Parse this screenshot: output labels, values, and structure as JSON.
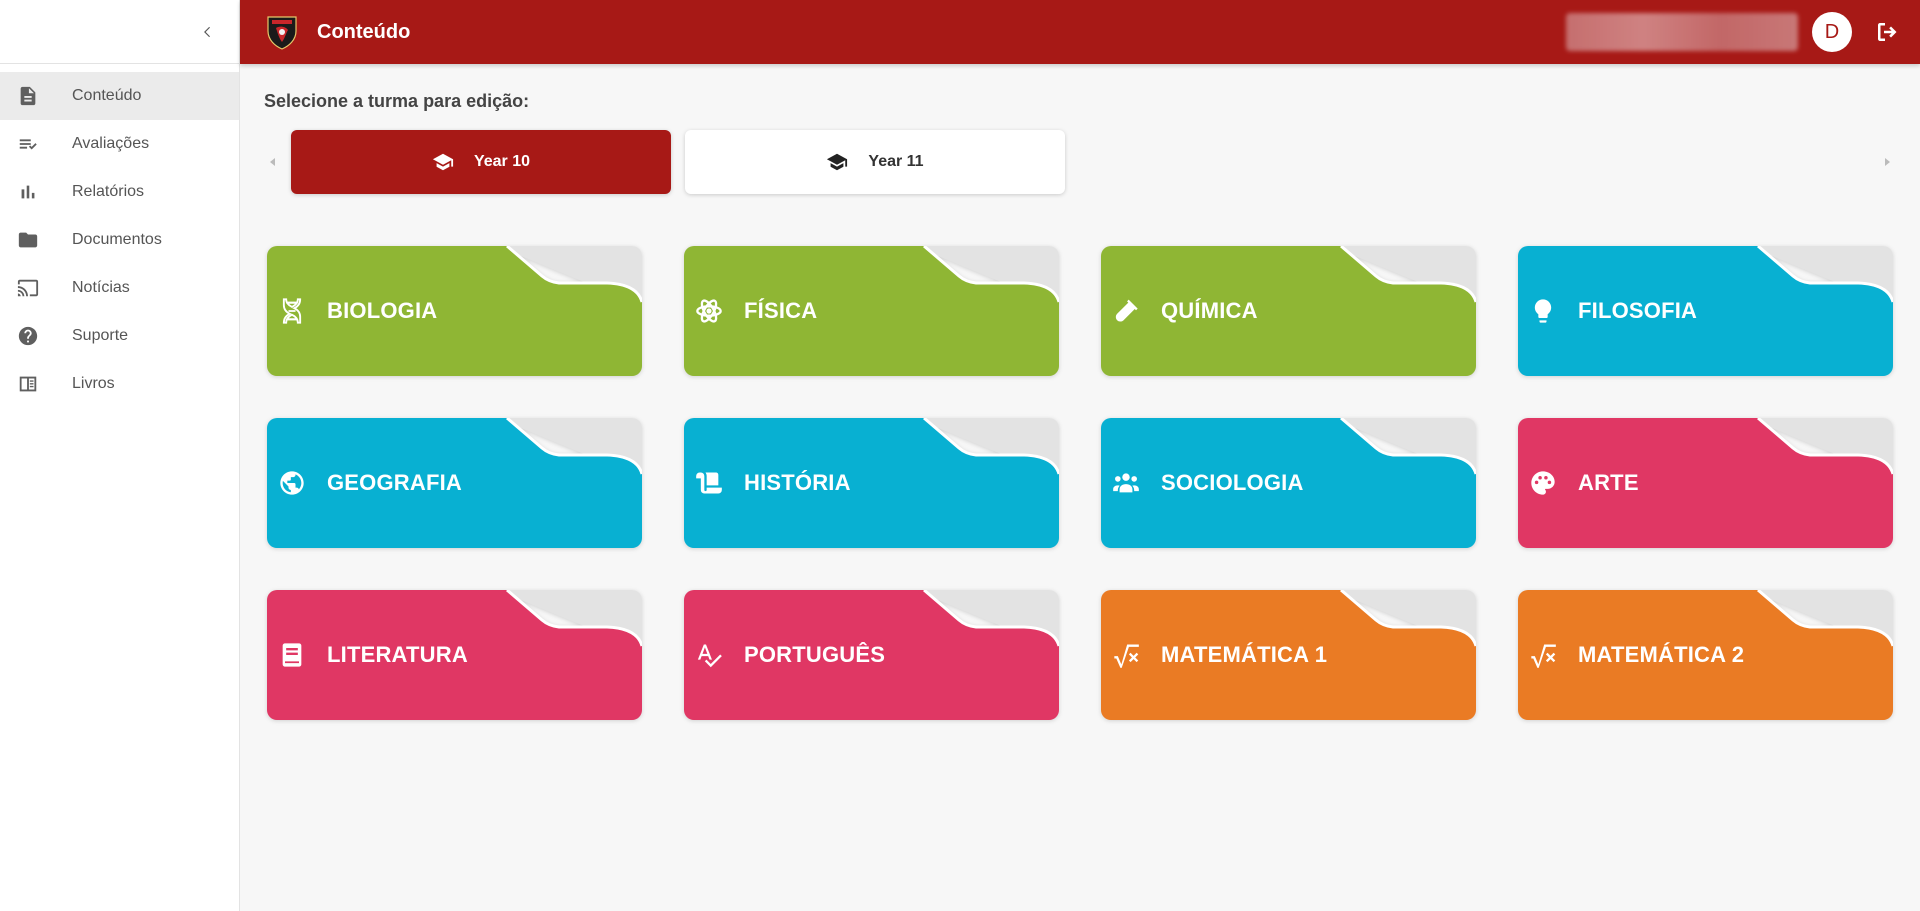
{
  "header": {
    "title": "Conteúdo",
    "avatar_initial": "D",
    "accent_color": "#a71916"
  },
  "sidebar": {
    "items": [
      {
        "label": "Conteúdo",
        "icon": "document-icon",
        "active": true
      },
      {
        "label": "Avaliações",
        "icon": "checklist-icon",
        "active": false
      },
      {
        "label": "Relatórios",
        "icon": "bar-chart-icon",
        "active": false
      },
      {
        "label": "Documentos",
        "icon": "folder-icon",
        "active": false
      },
      {
        "label": "Notícias",
        "icon": "cast-icon",
        "active": false
      },
      {
        "label": "Suporte",
        "icon": "help-icon",
        "active": false
      },
      {
        "label": "Livros",
        "icon": "book-icon",
        "active": false
      }
    ]
  },
  "main": {
    "section_title": "Selecione a turma para edição:",
    "classes": [
      {
        "label": "Year 10",
        "selected": true
      },
      {
        "label": "Year 11",
        "selected": false
      }
    ],
    "subjects": [
      {
        "label": "BIOLOGIA",
        "icon": "dna-icon",
        "color": "#8fb634"
      },
      {
        "label": "FÍSICA",
        "icon": "atom-icon",
        "color": "#8fb634"
      },
      {
        "label": "QUÍMICA",
        "icon": "test-tube-icon",
        "color": "#8fb634"
      },
      {
        "label": "FILOSOFIA",
        "icon": "lightbulb-icon",
        "color": "#08b0d2"
      },
      {
        "label": "GEOGRAFIA",
        "icon": "globe-icon",
        "color": "#08b0d2"
      },
      {
        "label": "HISTÓRIA",
        "icon": "scroll-icon",
        "color": "#08b0d2"
      },
      {
        "label": "SOCIOLOGIA",
        "icon": "people-icon",
        "color": "#08b0d2"
      },
      {
        "label": "ARTE",
        "icon": "palette-icon",
        "color": "#e03764"
      },
      {
        "label": "LITERATURA",
        "icon": "book-icon",
        "color": "#e03764"
      },
      {
        "label": "PORTUGUÊS",
        "icon": "spellcheck-icon",
        "color": "#e03764"
      },
      {
        "label": "MATEMÁTICA 1",
        "icon": "square-root-icon",
        "color": "#ea7b24"
      },
      {
        "label": "MATEMÁTICA 2",
        "icon": "square-root-icon",
        "color": "#ea7b24"
      }
    ]
  }
}
